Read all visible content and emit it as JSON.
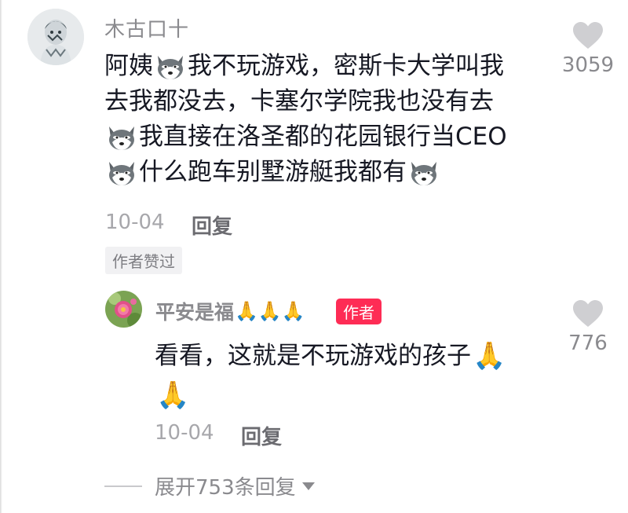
{
  "main_comment": {
    "username": "木古口十",
    "lines": [
      [
        "阿姨",
        "{dog}",
        "我不玩游戏，密斯卡大学叫我"
      ],
      [
        "去我都没去，卡塞尔学院我也没有去"
      ],
      [
        "{dog}",
        "我直接在洛圣都的花园银行当CEO"
      ],
      [
        "{dog}",
        "什么跑车别墅游艇我都有",
        "{dog}"
      ]
    ],
    "line_1_a": "阿姨",
    "line_1_b": "我不玩游戏，密斯卡大学叫我",
    "line_2": "去我都没去，卡塞尔学院我也没有去",
    "line_3": "我直接在洛圣都的花园银行当CEO",
    "line_4": "什么跑车别墅游艇我都有",
    "date": "10-04",
    "reply_label": "回复",
    "likes": "3059",
    "liked_by_author_badge": "作者赞过"
  },
  "reply_comment": {
    "username": "平安是福",
    "name_emoji": "🙏🙏🙏",
    "author_badge": "作者",
    "line_1": "看看，这就是不玩游戏的孩子",
    "line_1_emoji": "🙏",
    "line_2_emoji": "🙏",
    "date": "10-04",
    "reply_label": "回复",
    "likes": "776"
  },
  "expand_replies": {
    "label": "展开753条回复"
  },
  "icons": {
    "heart": "heart-icon",
    "dog_emoji": "husky-dog-emoji",
    "caret": "chevron-down-icon"
  },
  "colors": {
    "author_badge_bg": "#fe2c55",
    "heart": "#cfcfd2",
    "muted_text": "#8a8a8e"
  }
}
